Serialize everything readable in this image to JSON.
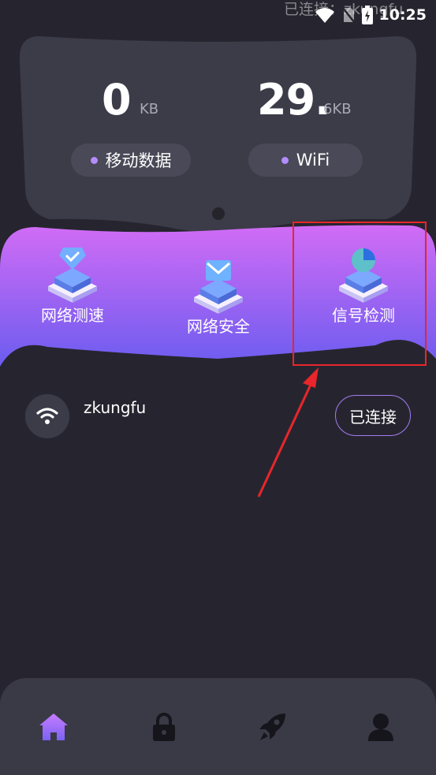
{
  "status_bar": {
    "ghost_text": "已连接：zkungfu",
    "time": "10:25"
  },
  "data_usage": {
    "mobile": {
      "value": "0",
      "unit": "KB",
      "label": "移动数据"
    },
    "wifi": {
      "value": "29.",
      "unit": "6KB",
      "label": "WiFi"
    }
  },
  "features": [
    {
      "label": "网络测速",
      "icon": "shield-check-icon"
    },
    {
      "label": "网络安全",
      "icon": "mail-box-icon"
    },
    {
      "label": "信号检测",
      "icon": "pie-chart-icon"
    }
  ],
  "wifi_list": [
    {
      "name": "zkungfu",
      "status": "已连接",
      "icon": "wifi-icon"
    }
  ],
  "bottom_nav": {
    "items": [
      {
        "icon": "home-icon",
        "active": true
      },
      {
        "icon": "lock-icon",
        "active": false
      },
      {
        "icon": "rocket-icon",
        "active": false
      },
      {
        "icon": "user-icon",
        "active": false
      }
    ]
  },
  "colors": {
    "background": "#26252f",
    "accent": "#b38cff",
    "banner_gradient_start": "#d16cf5",
    "banner_gradient_end": "#6b5cf0",
    "highlight": "#e8262b"
  }
}
